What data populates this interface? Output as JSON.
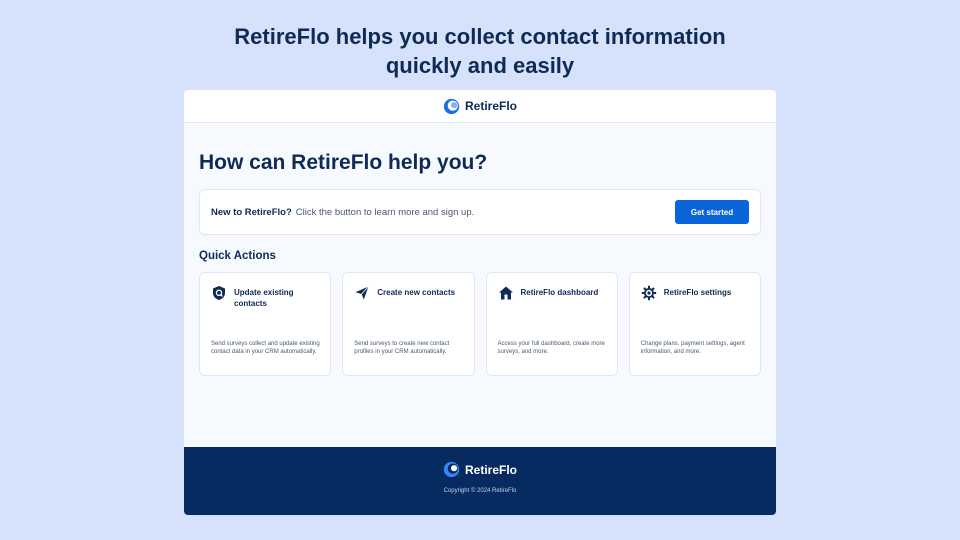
{
  "hero": {
    "line1": "RetireFlo helps you collect contact information",
    "line2": "quickly and easily"
  },
  "header": {
    "brand": "RetireFlo",
    "logo_icon": "retireflo-wave-logo"
  },
  "main": {
    "heading": "How can RetireFlo help you?",
    "signup": {
      "strong": "New to RetireFlo?",
      "text": "Click the button to learn more and sign up.",
      "button": "Get started"
    },
    "quick_actions_heading": "Quick Actions",
    "actions": [
      {
        "icon": "shield-icon",
        "title": "Update existing contacts",
        "desc": "Send surveys collect and update existing contact data in your CRM automatically."
      },
      {
        "icon": "paper-plane-icon",
        "title": "Create new contacts",
        "desc": "Send surveys to create new contact profiles in your CRM automatically."
      },
      {
        "icon": "home-icon",
        "title": "RetireFlo dashboard",
        "desc": "Access your full dashboard, create more surveys, and more."
      },
      {
        "icon": "gear-icon",
        "title": "RetireFlo settings",
        "desc": "Change plans, payment settings, agent information, and more."
      }
    ]
  },
  "footer": {
    "brand": "RetireFlo",
    "copyright": "Copyright © 2024 RetireFlo"
  },
  "colors": {
    "background": "#d6e2fb",
    "navy": "#0e2a55",
    "accent": "#0a66d8",
    "footer": "#052b61"
  }
}
